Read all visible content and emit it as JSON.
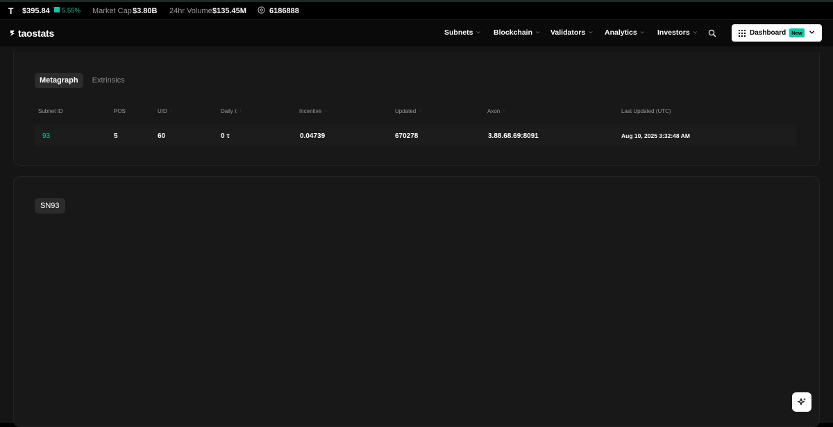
{
  "ticker": {
    "symbol": "T",
    "price": "$395.84",
    "change": "5.55%",
    "market_cap_label": "Market Cap",
    "market_cap": "$3.80B",
    "volume_label": "24hr Volume",
    "volume": "$135.45M",
    "block": "6186888"
  },
  "nav": {
    "logo": "taostats",
    "items": [
      "Subnets",
      "Blockchain",
      "Validators",
      "Analytics",
      "Investors"
    ],
    "dashboard_label": "Dashboard",
    "dashboard_badge": "New"
  },
  "metagraph": {
    "tabs": [
      "Metagraph",
      "Extrinsics"
    ],
    "columns": [
      "Subnet ID",
      "POS",
      "UID",
      "Daily τ",
      "Incentive",
      "Updated",
      "Axon",
      "Last Updated (UTC)"
    ],
    "rows": [
      {
        "subnet_id": "93",
        "pos": "5",
        "uid": "60",
        "daily": "0 τ",
        "incentive": "0.04739",
        "updated": "670278",
        "axon": "3.88.68.69:8091",
        "last_updated": "Aug 10, 2025 3:32:48 AM"
      }
    ]
  },
  "subnet_card": {
    "tag": "SN93"
  },
  "colors": {
    "accent": "#13c7a4",
    "background": "#151515",
    "card": "#181818"
  }
}
